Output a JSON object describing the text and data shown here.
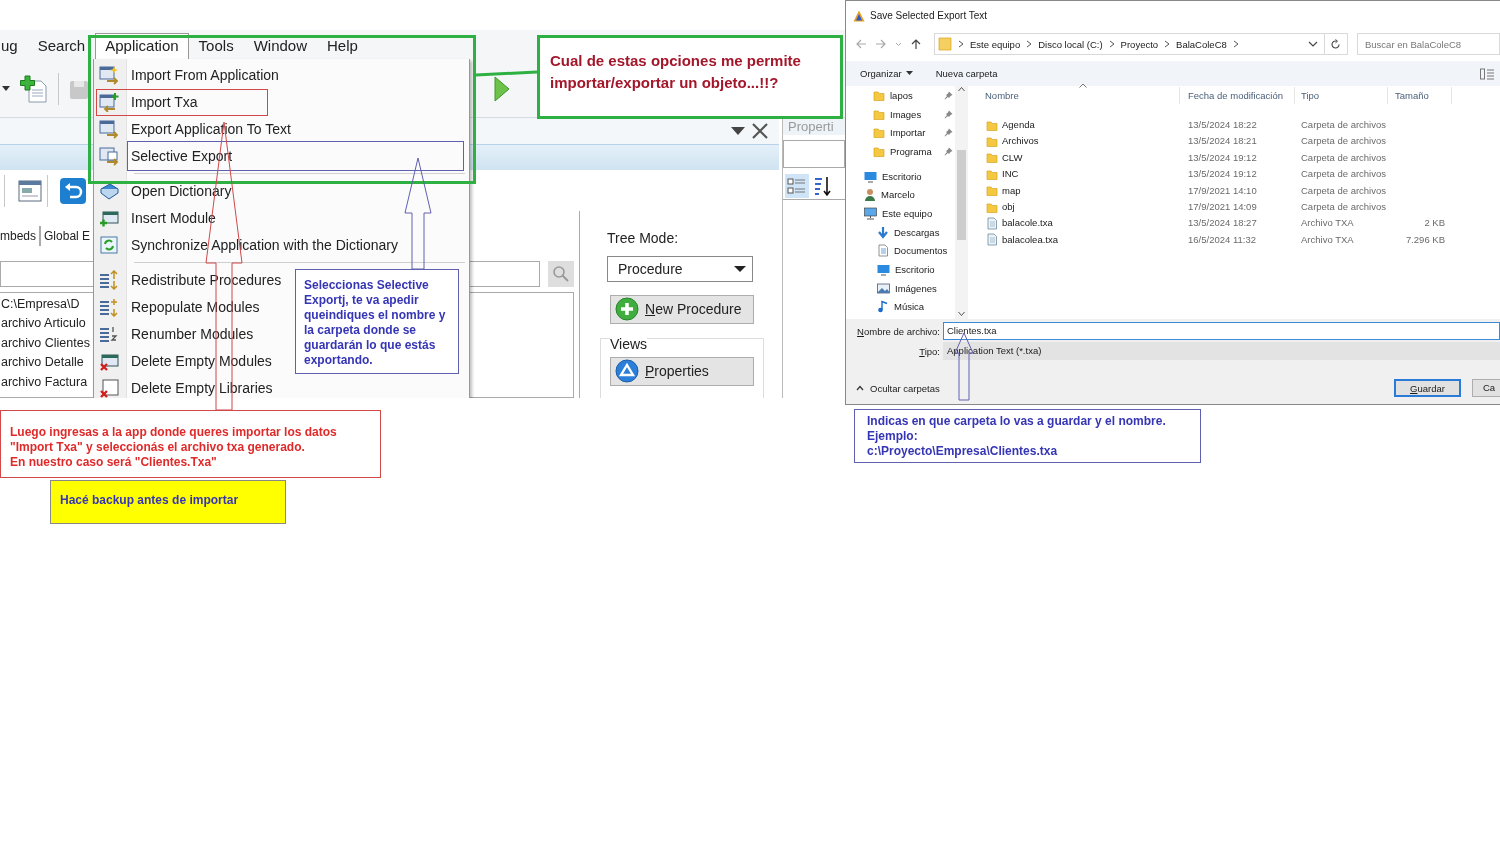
{
  "ide": {
    "menu_bar": [
      {
        "label": "ug",
        "selected": false
      },
      {
        "label": "Search",
        "selected": false
      },
      {
        "label": "Application",
        "selected": true
      },
      {
        "label": "Tools",
        "selected": false
      },
      {
        "label": "Window",
        "selected": false
      },
      {
        "label": "Help",
        "selected": false
      }
    ],
    "application_menu": {
      "groups": [
        [
          "Import From Application",
          "Import Txa",
          "Export Application To Text",
          "Selective Export"
        ],
        [
          "Open Dictionary",
          "Insert Module",
          "Synchronize Application with the Dictionary"
        ],
        [
          "Redistribute Procedures",
          "Repopulate Modules",
          "Renumber Modules",
          "Delete Empty Modules",
          "Delete Empty Libraries"
        ]
      ]
    },
    "tabs": [
      {
        "label": "mbeds",
        "selected": false
      },
      {
        "label": "Global E",
        "selected": false
      }
    ],
    "tree_items": [
      "C:\\Empresa\\D",
      "archivo Articulo",
      "archivo Clientes",
      "archivo Detalle",
      "archivo Factura"
    ],
    "tree_mode": {
      "label": "Tree Mode:",
      "value": "Procedure"
    },
    "new_procedure_button": "New Procedure",
    "views": {
      "label": "Views",
      "properties_button": "Properties"
    },
    "properties_panel": {
      "title": "Properti"
    }
  },
  "dialog": {
    "title": "Save Selected Export Text",
    "breadcrumb": [
      "Este equipo",
      "Disco local (C:)",
      "Proyecto",
      "BalaColeC8"
    ],
    "search": {
      "placeholder": "Buscar en BalaColeC8"
    },
    "toolbar": {
      "organize": "Organizar",
      "new_folder": "Nueva carpeta"
    },
    "nav_items": [
      {
        "label": "lapos",
        "kind": "folder",
        "pinned": true
      },
      {
        "label": "Images",
        "kind": "folder",
        "pinned": true
      },
      {
        "label": "Importar",
        "kind": "folder",
        "pinned": true
      },
      {
        "label": "Programa",
        "kind": "folder",
        "pinned": true
      },
      {
        "label": "Escritorio",
        "kind": "desktop",
        "pinned": false
      },
      {
        "label": "Marcelo",
        "kind": "user",
        "pinned": false
      },
      {
        "label": "Este equipo",
        "kind": "computer",
        "pinned": false,
        "children": [
          {
            "label": "Descargas",
            "kind": "download",
            "pinned": false
          },
          {
            "label": "Documentos",
            "kind": "document",
            "pinned": false
          },
          {
            "label": "Escritorio",
            "kind": "desktop",
            "pinned": false
          },
          {
            "label": "Imágenes",
            "kind": "picture",
            "pinned": false
          },
          {
            "label": "Música",
            "kind": "music",
            "pinned": false
          }
        ]
      }
    ],
    "columns": [
      "Nombre",
      "Fecha de modificación",
      "Tipo",
      "Tamaño"
    ],
    "rows": [
      {
        "kind": "folder",
        "name": "Agenda",
        "modified": "13/5/2024 18:22",
        "type": "Carpeta de archivos"
      },
      {
        "kind": "folder",
        "name": "Archivos",
        "modified": "13/5/2024 18:21",
        "type": "Carpeta de archivos"
      },
      {
        "kind": "folder",
        "name": "CLW",
        "modified": "13/5/2024 19:12",
        "type": "Carpeta de archivos"
      },
      {
        "kind": "folder",
        "name": "INC",
        "modified": "13/5/2024 19:12",
        "type": "Carpeta de archivos"
      },
      {
        "kind": "folder",
        "name": "map",
        "modified": "17/9/2021 14:10",
        "type": "Carpeta de archivos"
      },
      {
        "kind": "folder",
        "name": "obj",
        "modified": "17/9/2021 14:09",
        "type": "Carpeta de archivos"
      },
      {
        "kind": "file",
        "name": "balacole.txa",
        "modified": "13/5/2024 18:27",
        "type": "Archivo TXA",
        "size": "2 KB"
      },
      {
        "kind": "file",
        "name": "balacolea.txa",
        "modified": "16/5/2024 11:32",
        "type": "Archivo TXA",
        "size": "7.296 KB"
      }
    ],
    "file_name": {
      "label": "Nombre de archivo:",
      "value": "Clientes.txa"
    },
    "file_type": {
      "label": "Tipo:",
      "value": "Application Text (*.txa)"
    },
    "hide_folders": "Ocultar carpetas",
    "buttons": [
      "Guardar",
      "Ca"
    ]
  },
  "annotations": {
    "question": {
      "lines": [
        "Cual de estas opciones me permite",
        "importar/exportar un objeto...!!?"
      ]
    },
    "export_note": {
      "lines": [
        "Seleccionas Selective",
        "Exportj, te va apedir",
        "queindiques el nombre y",
        "la carpeta donde se",
        "guardarán lo que estás",
        "exportando."
      ]
    },
    "import_note": {
      "lines": [
        "Luego ingresas a la app donde queres importar los datos",
        "\"Import Txa\" y seleccionás el archivo txa generado.",
        "En nuestro caso será  \"Clientes.Txa\""
      ]
    },
    "backup_note": {
      "lines": [
        "Hacé backup antes de importar"
      ]
    },
    "filename_note": {
      "lines": [
        "Indicas en que carpeta lo vas a guardar y el nombre.",
        "Ejemplo:",
        "c:\\Proyecto\\Empresa\\Clientes.txa"
      ]
    }
  }
}
